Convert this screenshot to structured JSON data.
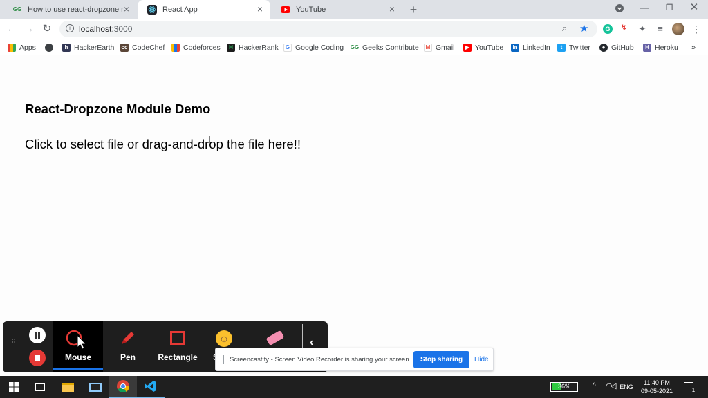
{
  "tabs": [
    {
      "title": "How to use react-dropzone mod",
      "favicon": "gfg-icon",
      "active": false
    },
    {
      "title": "React App",
      "favicon": "react-icon",
      "active": true
    },
    {
      "title": "YouTube",
      "favicon": "youtube-icon",
      "active": false
    }
  ],
  "toolbar": {
    "url_host": "localhost",
    "url_port": ":3000"
  },
  "bookmarks": [
    {
      "label": "Apps",
      "icon": "apps-grid-icon"
    },
    {
      "label": "",
      "icon": "globe-icon"
    },
    {
      "label": "HackerEarth",
      "icon": "hackerearth-icon"
    },
    {
      "label": "CodeChef",
      "icon": "codechef-icon"
    },
    {
      "label": "Codeforces",
      "icon": "codeforces-icon"
    },
    {
      "label": "HackerRank",
      "icon": "hackerrank-icon"
    },
    {
      "label": "Google Coding",
      "icon": "google-icon"
    },
    {
      "label": "Geeks Contribute",
      "icon": "gfg-icon"
    },
    {
      "label": "Gmail",
      "icon": "gmail-icon"
    },
    {
      "label": "YouTube",
      "icon": "youtube-icon"
    },
    {
      "label": "LinkedIn",
      "icon": "linkedin-icon"
    },
    {
      "label": "Twitter",
      "icon": "twitter-icon"
    },
    {
      "label": "GitHub",
      "icon": "github-icon"
    },
    {
      "label": "Heroku",
      "icon": "heroku-icon"
    }
  ],
  "page": {
    "heading": "React-Dropzone Module Demo",
    "dropzone_text": "Click to select file or drag-and-drop the file here!!"
  },
  "screencastify": {
    "tools": [
      {
        "label": "Mouse",
        "icon": "mouse-cursor-icon",
        "active": true
      },
      {
        "label": "Pen",
        "icon": "pen-icon",
        "active": false
      },
      {
        "label": "Rectangle",
        "icon": "rectangle-icon",
        "active": false
      },
      {
        "label": "S",
        "icon": "sticker-icon",
        "active": false
      },
      {
        "label": "",
        "icon": "eraser-icon",
        "active": false
      }
    ],
    "banner_message": "Screencastify - Screen Video Recorder is sharing your screen.",
    "stop_label": "Stop sharing",
    "hide_label": "Hide"
  },
  "taskbar": {
    "battery": "36%",
    "language": "ENG",
    "time": "11:40 PM",
    "date": "09-05-2021",
    "notification_count": "1"
  },
  "colors": {
    "accent": "#1a73e8",
    "stop_red": "#e53935",
    "youtube_red": "#ff0000"
  }
}
